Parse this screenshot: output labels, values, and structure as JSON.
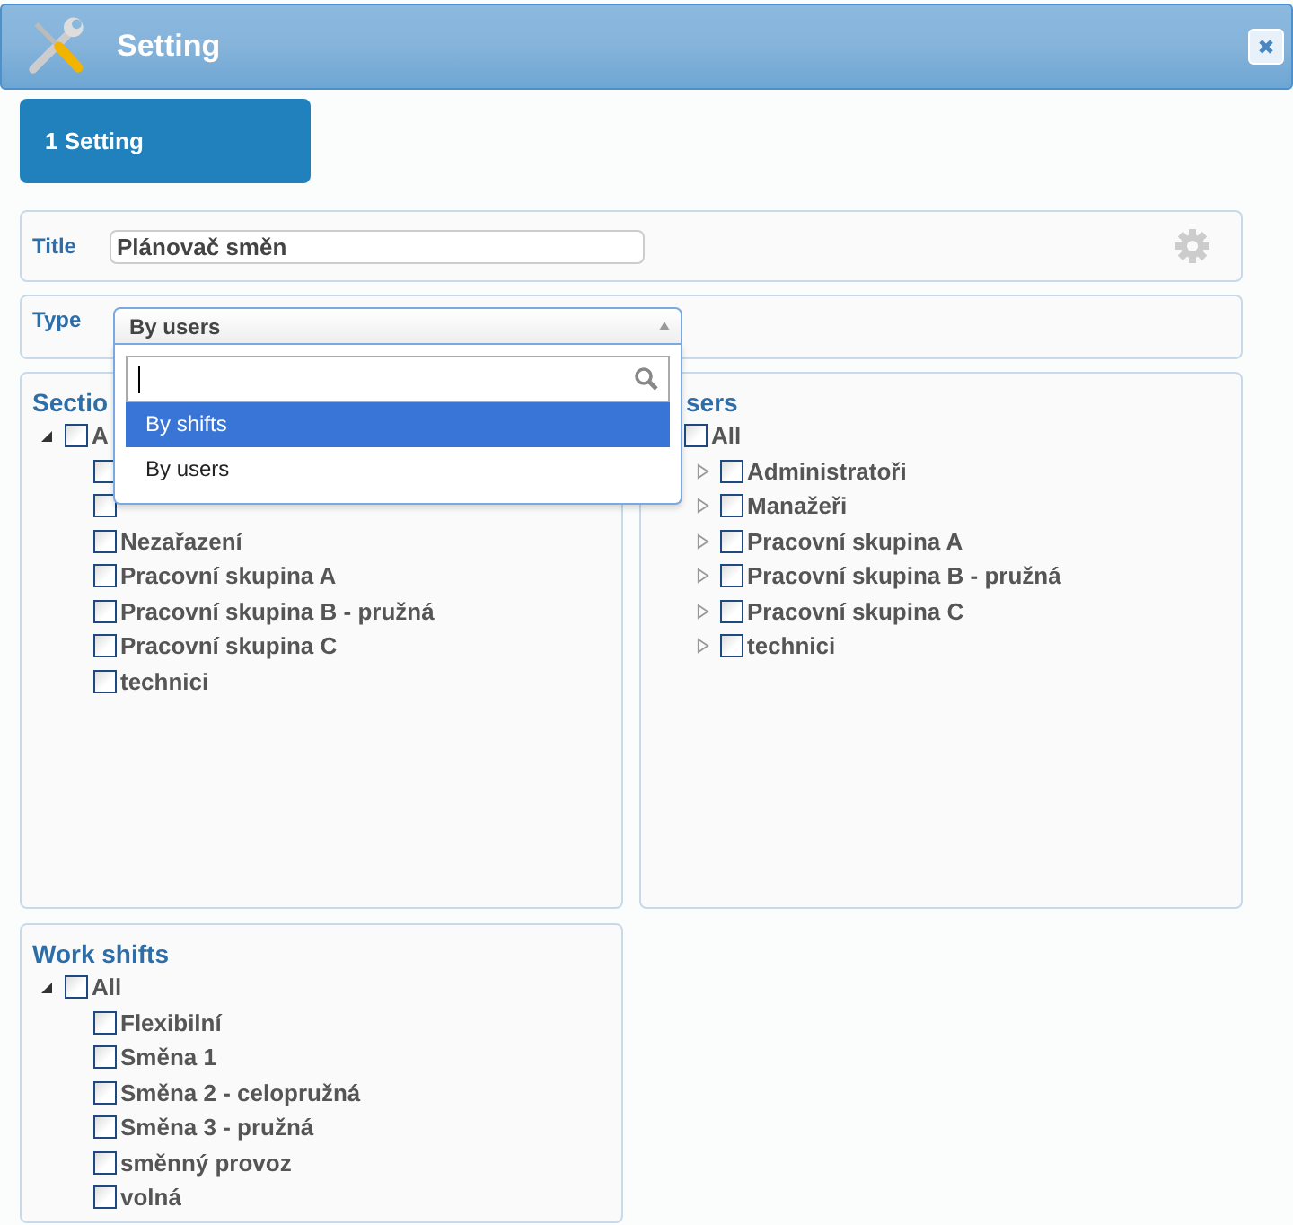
{
  "window": {
    "title": "Setting"
  },
  "tabs": [
    {
      "label": "1 Setting",
      "selected": true
    }
  ],
  "title_field": {
    "label": "Title",
    "value": "Plánovač směn"
  },
  "type_field": {
    "label": "Type",
    "value": "By users",
    "open": true,
    "options": [
      {
        "label": "By shifts",
        "highlighted": true
      },
      {
        "label": "By users",
        "highlighted": false
      }
    ]
  },
  "panels": [
    {
      "title": "Sectio",
      "tree": [
        {
          "label": "A",
          "checked": false,
          "expanded": true,
          "children": [
            {
              "checked": false
            },
            {
              "checked": false
            },
            {
              "label": "Nezařazení",
              "checked": false
            },
            {
              "label": "Pracovní skupina A",
              "checked": false
            },
            {
              "label": "Pracovní skupina B - pružná",
              "checked": false
            },
            {
              "label": "Pracovní skupina C",
              "checked": false
            },
            {
              "label": "technici",
              "checked": false
            }
          ]
        }
      ]
    },
    {
      "title": "sers",
      "tree": [
        {
          "label": "All",
          "checked": false,
          "children": [
            {
              "label": "Administratoři",
              "checked": false,
              "expanded": false
            },
            {
              "label": "Manažeři",
              "checked": false,
              "expanded": false
            },
            {
              "label": "Pracovní skupina A",
              "checked": false,
              "expanded": false
            },
            {
              "label": "Pracovní skupina B - pružná",
              "checked": false,
              "expanded": false
            },
            {
              "label": "Pracovní skupina C",
              "checked": false,
              "expanded": false
            },
            {
              "label": "technici",
              "checked": false,
              "expanded": false
            }
          ]
        }
      ]
    },
    {
      "title": "Work shifts",
      "tree": [
        {
          "label": "All",
          "checked": false,
          "expanded": true,
          "children": [
            {
              "label": "Flexibilní",
              "checked": false
            },
            {
              "label": "Směna 1",
              "checked": false
            },
            {
              "label": "Směna 2 - celopružná",
              "checked": false
            },
            {
              "label": "Směna 3 - pružná",
              "checked": false
            },
            {
              "label": "směnný provoz",
              "checked": false
            },
            {
              "label": "volná",
              "checked": false
            }
          ]
        }
      ]
    }
  ]
}
